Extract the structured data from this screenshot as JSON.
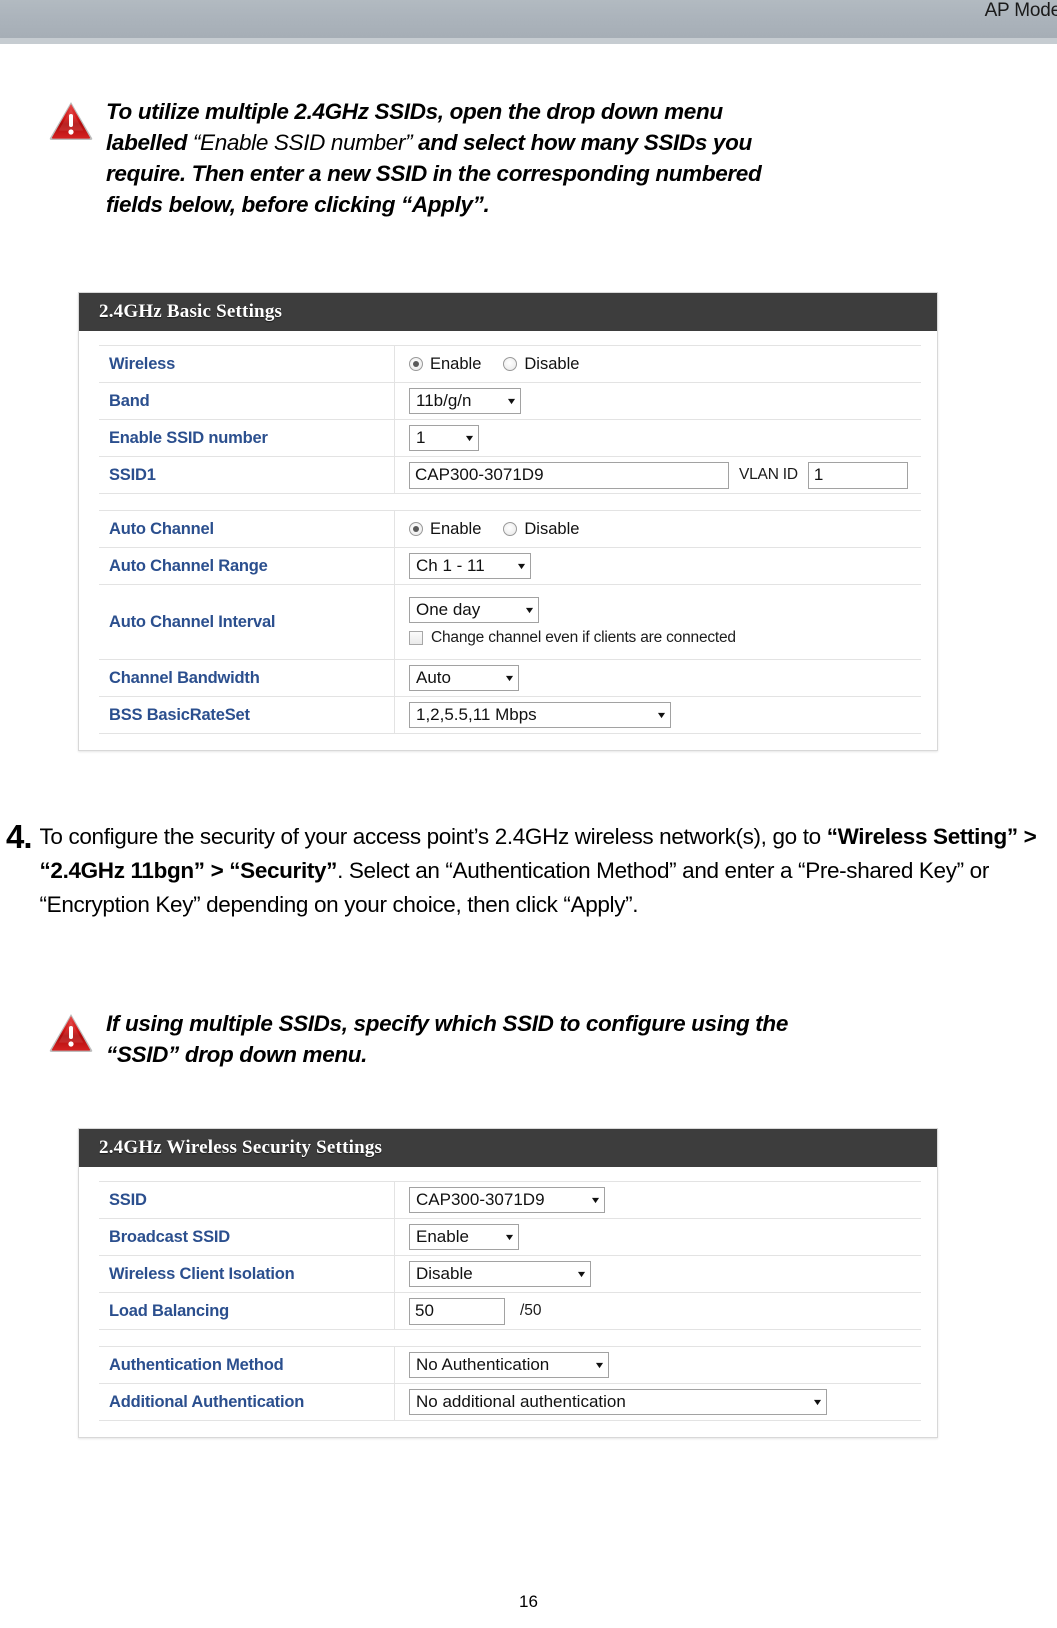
{
  "header": {
    "title": "AP Mode"
  },
  "note1": {
    "icon": "warning-triangle-icon",
    "line1_a": "To utilize multiple 2.4GHz SSIDs, open the drop down menu",
    "line2_a": "labelled ",
    "line2_quote": "“Enable SSID number”",
    "line2_b": " and select how many SSIDs you",
    "line3": "require. Then enter a new SSID in the corresponding numbered",
    "line4": "fields below, before clicking “Apply”."
  },
  "panel1": {
    "title": "2.4GHz Basic Settings",
    "group1": [
      {
        "label": "Wireless",
        "type": "radio",
        "options": [
          "Enable",
          "Disable"
        ],
        "selected": "Enable"
      },
      {
        "label": "Band",
        "type": "select",
        "value": "11b/g/n"
      },
      {
        "label": "Enable SSID number",
        "type": "select",
        "value": "1"
      },
      {
        "label": "SSID1",
        "type": "text_vlan",
        "value": "CAP300-3071D9",
        "vlan_label": "VLAN ID",
        "vlan_value": "1"
      }
    ],
    "group2": [
      {
        "label": "Auto Channel",
        "type": "radio",
        "options": [
          "Enable",
          "Disable"
        ],
        "selected": "Enable"
      },
      {
        "label": "Auto Channel Range",
        "type": "select",
        "value": "Ch 1 - 11"
      },
      {
        "label": "Auto Channel Interval",
        "type": "select_check",
        "value": "One day",
        "checkbox_label": "Change channel even if clients are connected",
        "checked": false
      },
      {
        "label": "Channel Bandwidth",
        "type": "select",
        "value": "Auto"
      },
      {
        "label": "BSS BasicRateSet",
        "type": "select",
        "value": "1,2,5.5,11 Mbps"
      }
    ]
  },
  "step4": {
    "number": "4.",
    "t1": "To configure the security of your access point’s 2.4GHz wireless network(s),",
    "t2": "go to ",
    "b1": "“Wireless Setting” > “2.4GHz 11bgn” > “Security”",
    "t3": ". Select an “Authentication Method” and enter a “Pre-shared Key” or “Encryption Key” depending on your choice, then click “Apply”."
  },
  "note2": {
    "icon": "warning-triangle-icon",
    "line1": "If using multiple SSIDs, specify which SSID to configure using the",
    "line2": "“SSID” drop down menu."
  },
  "panel2": {
    "title": "2.4GHz Wireless Security Settings",
    "group1": [
      {
        "label": "SSID",
        "type": "select",
        "value": "CAP300-3071D9"
      },
      {
        "label": "Broadcast SSID",
        "type": "select",
        "value": "Enable"
      },
      {
        "label": "Wireless Client Isolation",
        "type": "select",
        "value": "Disable"
      },
      {
        "label": "Load Balancing",
        "type": "text_suffix",
        "value": "50",
        "suffix": "/50"
      }
    ],
    "group2": [
      {
        "label": "Authentication Method",
        "type": "select",
        "value": "No Authentication"
      },
      {
        "label": "Additional Authentication",
        "type": "select",
        "value": "No additional authentication"
      }
    ]
  },
  "footer": {
    "page_number": "16"
  },
  "colors": {
    "header_band": "#aab2ba",
    "panel_header": "#3d3d3d",
    "label_text": "#2b4f8e",
    "warning_red": "#cc1111"
  }
}
